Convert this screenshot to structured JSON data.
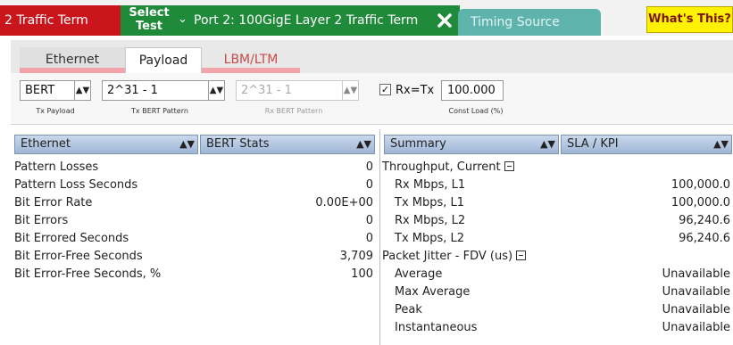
{
  "tabs": {
    "prev_tab_label": "2 Traffic Term",
    "select_test_label": "Select\nTest",
    "active_port_title": "Port 2: 100GigE Layer 2 Traffic Term",
    "timing_source_label": "Timing Source",
    "whats_this_label": "What's This?"
  },
  "subtabs": [
    "Ethernet",
    "Payload",
    "LBM/LTM"
  ],
  "config": {
    "tx_payload": {
      "value": "BERT",
      "label": "Tx Payload"
    },
    "tx_pattern": {
      "value": "2^31 - 1",
      "label": "Tx BERT Pattern"
    },
    "rx_pattern": {
      "value": "2^31 - 1",
      "label": "Rx BERT Pattern"
    },
    "rx_eq_tx_label": "Rx=Tx",
    "rx_eq_tx_checked": true,
    "const_load": {
      "value": "100.000",
      "label": "Const Load (%)"
    }
  },
  "left_panel": {
    "category": "Ethernet",
    "view": "BERT Stats",
    "rows": [
      {
        "label": "Pattern Losses",
        "value": "0"
      },
      {
        "label": "Pattern Loss Seconds",
        "value": "0"
      },
      {
        "label": "Bit Error Rate",
        "value": "0.00E+00"
      },
      {
        "label": "Bit Errors",
        "value": "0"
      },
      {
        "label": "Bit Errored Seconds",
        "value": "0"
      },
      {
        "label": "Bit Error-Free Seconds",
        "value": "3,709"
      },
      {
        "label": "Bit Error-Free Seconds, %",
        "value": "100"
      }
    ]
  },
  "right_panel": {
    "category": "Summary",
    "view": "SLA / KPI",
    "groups": [
      {
        "title": "Throughput, Current",
        "rows": [
          {
            "label": "Rx Mbps, L1",
            "value": "100,000.0"
          },
          {
            "label": "Tx Mbps, L1",
            "value": "100,000.0"
          },
          {
            "label": "Rx Mbps, L2",
            "value": "96,240.6"
          },
          {
            "label": "Tx Mbps, L2",
            "value": "96,240.6"
          }
        ]
      },
      {
        "title": "Packet Jitter - FDV (us)",
        "rows": [
          {
            "label": "Average",
            "value": "Unavailable"
          },
          {
            "label": "Max Average",
            "value": "Unavailable"
          },
          {
            "label": "Peak",
            "value": "Unavailable"
          },
          {
            "label": "Instantaneous",
            "value": "Unavailable"
          }
        ]
      }
    ]
  },
  "colors": {
    "prev_tab": "#c9151b",
    "active_tab": "#1f8a3a",
    "timing_tab": "#5fb3ad",
    "whats_this": "#fff200",
    "header_select": "#b3c7e2"
  }
}
